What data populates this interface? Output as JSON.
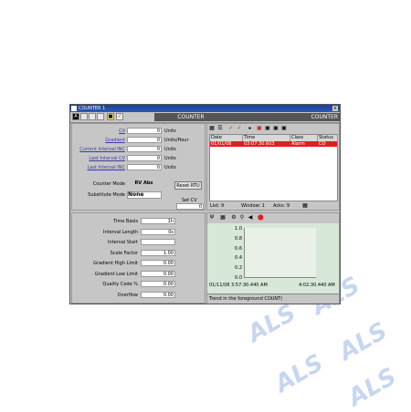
{
  "window": {
    "title": "COUNTER 1",
    "close_glyph": "x"
  },
  "toolbar": {
    "mode_letter": "A",
    "header_title": "COUNTER",
    "header_right": "COUNTER"
  },
  "values": {
    "rows": [
      {
        "label": "CV",
        "value": "0",
        "unit": "Units"
      },
      {
        "label": "Gradient",
        "value": "0",
        "unit": "Units/Hour"
      },
      {
        "label": "Current Interval INC",
        "value": "0",
        "unit": "Units"
      },
      {
        "label": "Last Interval CV",
        "value": "0",
        "unit": "Units"
      },
      {
        "label": "Last Interval INC",
        "value": "0",
        "unit": "Units"
      }
    ],
    "counter_mode_label": "Counter Mode",
    "counter_mode_value": "RV Abs",
    "reset_button": "Reset RTU",
    "substitute_mode_label": "Substitute Mode",
    "substitute_mode_value": "None",
    "set_cv_label": "Set CV",
    "set_cv_value": "0"
  },
  "config": {
    "rows": [
      {
        "label": "Time Basis",
        "value": "1h"
      },
      {
        "label": "Interval Length",
        "value": "0s"
      },
      {
        "label": "Interval Start",
        "value": ""
      },
      {
        "label": "Scale Factor",
        "value": "1.00"
      },
      {
        "label": "Gradient High Limit",
        "value": "0.00"
      },
      {
        "label": "Gradient Low Limit",
        "value": "0.00"
      },
      {
        "label": "Quality Code %",
        "value": "0.00"
      },
      {
        "label": "Overflow",
        "value": "0.00"
      }
    ]
  },
  "alarms": {
    "columns": [
      "Date",
      "Time",
      "Class",
      "Status"
    ],
    "rows": [
      {
        "date": "01/01/08",
        "time": "03:07:30.603",
        "class": "Alarm",
        "status": "CO"
      }
    ],
    "status": {
      "list": "List: 9",
      "window": "Window: 1",
      "acks": "Acks: 9"
    }
  },
  "trend": {
    "y_ticks": [
      "1.0",
      "0.8",
      "0.6",
      "0.4",
      "0.2",
      "0.0"
    ],
    "left_time": "01/11/08 3:57:30.440 AM",
    "right_time": "4:02:30.440 AM",
    "status_text": "Trend in the foreground COUNT("
  },
  "watermark": {
    "text": "ALS"
  },
  "colors": {
    "titlebar": "#2a5bc0",
    "alarm_row": "#e02020",
    "header_bar": "#555555"
  }
}
